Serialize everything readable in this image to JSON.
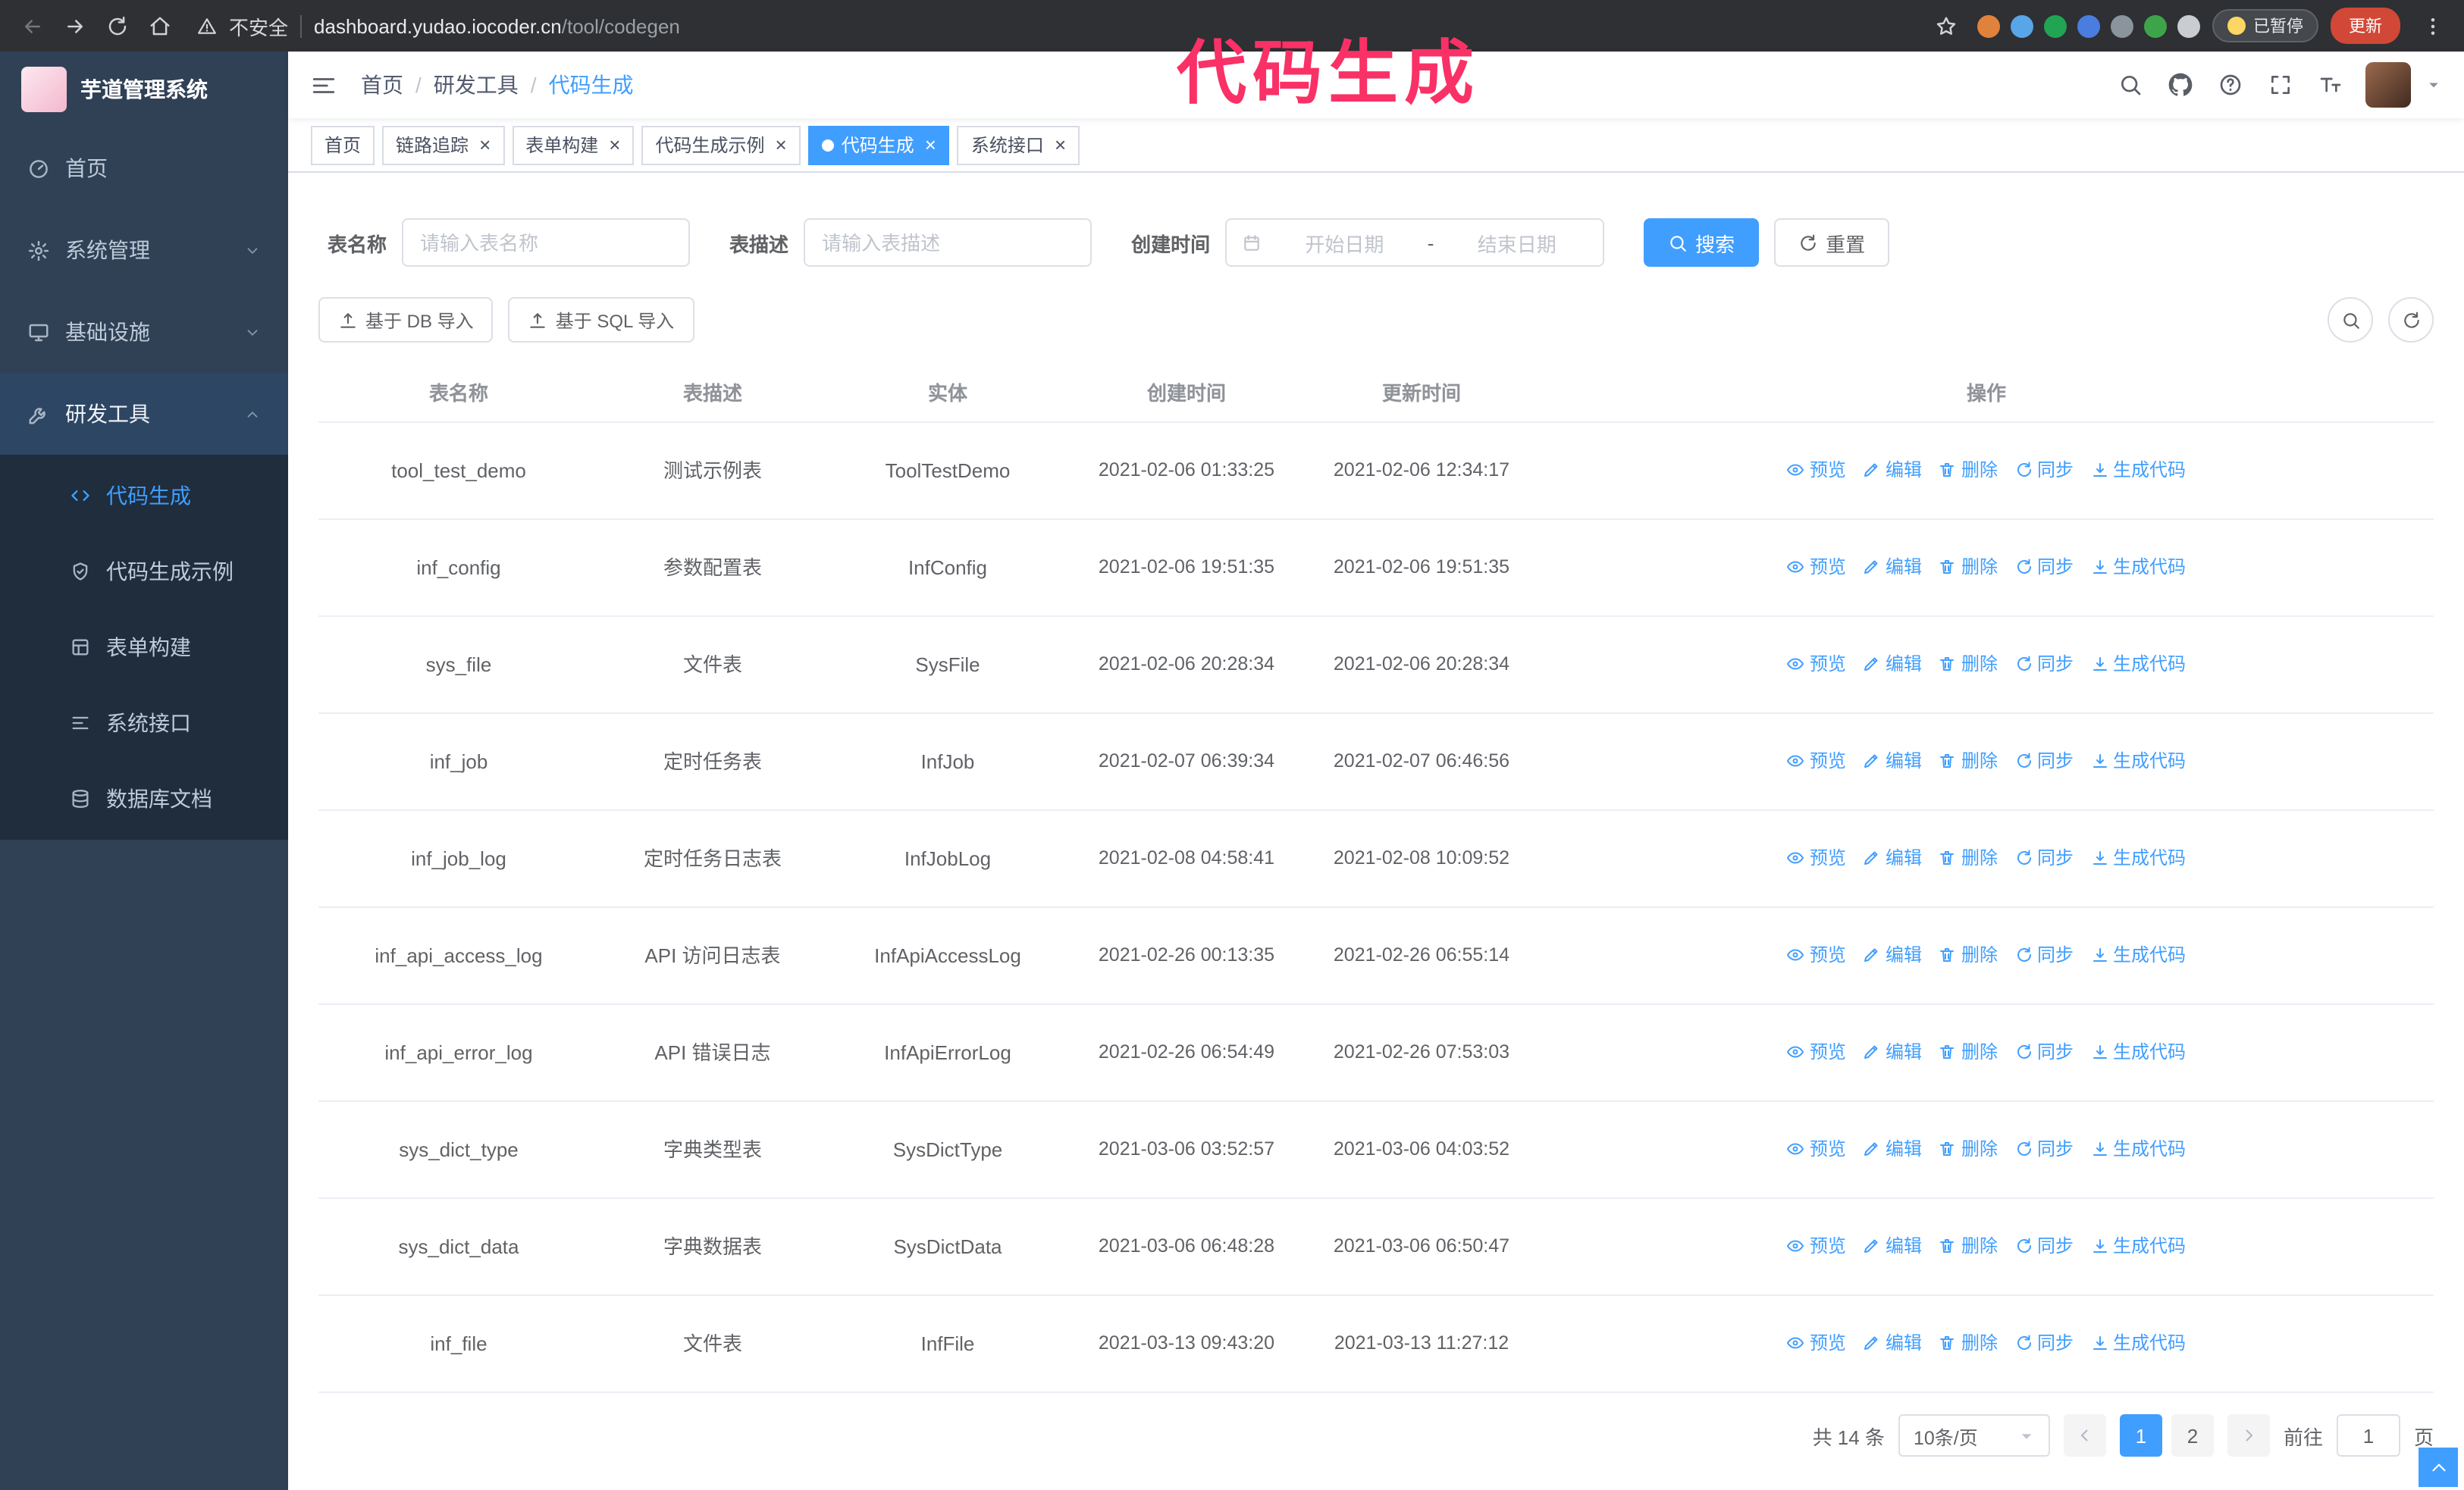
{
  "annotation": {
    "text": "代码生成"
  },
  "colors": {
    "accent": "#409eff",
    "annotation": "#fa3166",
    "sidebar_bg": "#304156",
    "submenu_bg": "#1f2d3d",
    "update_button": "#d14836"
  },
  "browser": {
    "security_label": "不安全",
    "url_host": "dashboard.yudao.iocoder.cn",
    "url_path": "/tool/codegen",
    "paused_badge": "已暂停",
    "update_button": "更新",
    "nav_icons": [
      "back-icon",
      "forward-icon",
      "refresh-icon",
      "home-icon"
    ],
    "extension_icons": [
      {
        "name": "fox-extension-icon",
        "color": "#e0823c"
      },
      {
        "name": "drop-extension-icon",
        "color": "#58a6e8"
      },
      {
        "name": "v-extension-icon",
        "color": "#21a453"
      },
      {
        "name": "grid-extension-icon",
        "color": "#4a7de0"
      },
      {
        "name": "box-extension-icon",
        "color": "#8a949c"
      },
      {
        "name": "leaf-extension-icon",
        "color": "#3ea44a"
      },
      {
        "name": "puzzle-extension-icon",
        "color": "#c9ccd1"
      }
    ]
  },
  "sidebar": {
    "logo_title": "芋道管理系统",
    "menu": [
      {
        "label": "首页",
        "icon": "dashboard-icon",
        "type": "item",
        "state": "none"
      },
      {
        "label": "系统管理",
        "icon": "gear-icon",
        "type": "group",
        "state": "collapsed"
      },
      {
        "label": "基础设施",
        "icon": "monitor-icon",
        "type": "group",
        "state": "collapsed"
      },
      {
        "label": "研发工具",
        "icon": "wrench-icon",
        "type": "group",
        "state": "expanded"
      }
    ],
    "submenu": [
      {
        "label": "代码生成",
        "icon": "code-icon",
        "active": true
      },
      {
        "label": "代码生成示例",
        "icon": "shield-icon",
        "active": false
      },
      {
        "label": "表单构建",
        "icon": "form-icon",
        "active": false
      },
      {
        "label": "系统接口",
        "icon": "api-icon",
        "active": false
      },
      {
        "label": "数据库文档",
        "icon": "database-icon",
        "active": false
      }
    ]
  },
  "header": {
    "breadcrumb": [
      "首页",
      "研发工具",
      "代码生成"
    ],
    "icons": [
      {
        "name": "header-search-button",
        "icon": "search-icon"
      },
      {
        "name": "github-link",
        "icon": "github-icon"
      },
      {
        "name": "help-button",
        "icon": "help-icon"
      },
      {
        "name": "fullscreen-button",
        "icon": "fullscreen-icon"
      },
      {
        "name": "font-size-button",
        "icon": "font-size-icon"
      }
    ]
  },
  "tabs": [
    {
      "label": "首页",
      "closable": false,
      "active": false
    },
    {
      "label": "链路追踪",
      "closable": true,
      "active": false
    },
    {
      "label": "表单构建",
      "closable": true,
      "active": false
    },
    {
      "label": "代码生成示例",
      "closable": true,
      "active": false
    },
    {
      "label": "代码生成",
      "closable": true,
      "active": true
    },
    {
      "label": "系统接口",
      "closable": true,
      "active": false
    }
  ],
  "filters": {
    "table_name_label": "表名称",
    "table_name_placeholder": "请输入表名称",
    "table_desc_label": "表描述",
    "table_desc_placeholder": "请输入表描述",
    "create_time_label": "创建时间",
    "start_date_placeholder": "开始日期",
    "date_separator": "-",
    "end_date_placeholder": "结束日期",
    "search_button": "搜索",
    "reset_button": "重置"
  },
  "toolbar": {
    "import_db": "基于 DB 导入",
    "import_sql": "基于 SQL 导入"
  },
  "table": {
    "columns": [
      "表名称",
      "表描述",
      "实体",
      "创建时间",
      "更新时间",
      "操作"
    ],
    "row_actions": [
      {
        "label": "预览",
        "icon": "eye-icon"
      },
      {
        "label": "编辑",
        "icon": "edit-icon"
      },
      {
        "label": "删除",
        "icon": "trash-icon"
      },
      {
        "label": "同步",
        "icon": "sync-icon"
      },
      {
        "label": "生成代码",
        "icon": "download-icon"
      }
    ],
    "rows": [
      {
        "name": "tool_test_demo",
        "desc": "测试示例表",
        "entity": "ToolTestDemo",
        "created": "2021-02-06 01:33:25",
        "updated": "2021-02-06 12:34:17"
      },
      {
        "name": "inf_config",
        "desc": "参数配置表",
        "entity": "InfConfig",
        "created": "2021-02-06 19:51:35",
        "updated": "2021-02-06 19:51:35"
      },
      {
        "name": "sys_file",
        "desc": "文件表",
        "entity": "SysFile",
        "created": "2021-02-06 20:28:34",
        "updated": "2021-02-06 20:28:34"
      },
      {
        "name": "inf_job",
        "desc": "定时任务表",
        "entity": "InfJob",
        "created": "2021-02-07 06:39:34",
        "updated": "2021-02-07 06:46:56"
      },
      {
        "name": "inf_job_log",
        "desc": "定时任务日志表",
        "entity": "InfJobLog",
        "created": "2021-02-08 04:58:41",
        "updated": "2021-02-08 10:09:52"
      },
      {
        "name": "inf_api_access_log",
        "desc": "API 访问日志表",
        "entity": "InfApiAccessLog",
        "created": "2021-02-26 00:13:35",
        "updated": "2021-02-26 06:55:14"
      },
      {
        "name": "inf_api_error_log",
        "desc": "API 错误日志",
        "entity": "InfApiErrorLog",
        "created": "2021-02-26 06:54:49",
        "updated": "2021-02-26 07:53:03"
      },
      {
        "name": "sys_dict_type",
        "desc": "字典类型表",
        "entity": "SysDictType",
        "created": "2021-03-06 03:52:57",
        "updated": "2021-03-06 04:03:52"
      },
      {
        "name": "sys_dict_data",
        "desc": "字典数据表",
        "entity": "SysDictData",
        "created": "2021-03-06 06:48:28",
        "updated": "2021-03-06 06:50:47"
      },
      {
        "name": "inf_file",
        "desc": "文件表",
        "entity": "InfFile",
        "created": "2021-03-13 09:43:20",
        "updated": "2021-03-13 11:27:12"
      }
    ]
  },
  "pagination": {
    "total_text": "共 14 条",
    "page_size": "10条/页",
    "pages": [
      "1",
      "2"
    ],
    "active_page": "1",
    "goto_label": "前往",
    "goto_value": "1",
    "goto_suffix": "页"
  }
}
